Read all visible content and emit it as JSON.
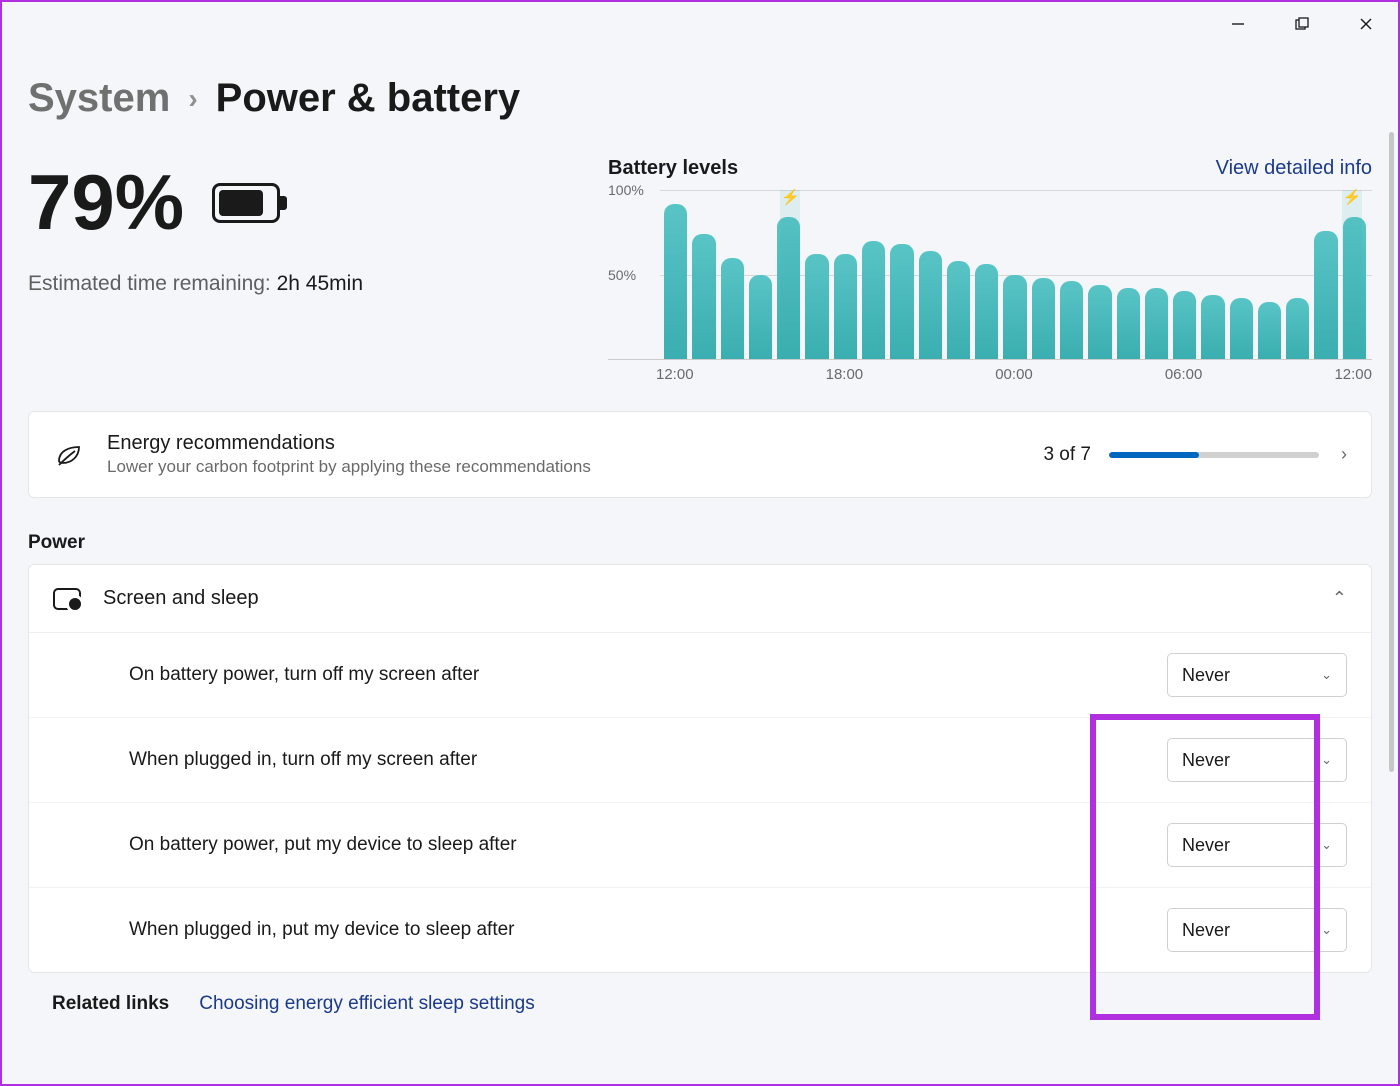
{
  "breadcrumb": {
    "parent": "System",
    "current": "Power & battery"
  },
  "battery": {
    "percent": "79%",
    "estimate_label": "Estimated time remaining:",
    "estimate_value": "2h 45min"
  },
  "chart_header": {
    "title": "Battery levels",
    "link": "View detailed info"
  },
  "chart_data": {
    "type": "bar",
    "ylabel": "",
    "ylim": [
      0,
      100
    ],
    "yticks": [
      "50%",
      "100%"
    ],
    "xticks": [
      "12:00",
      "18:00",
      "00:00",
      "06:00",
      "12:00"
    ],
    "charging_markers_at_index": [
      4,
      24
    ],
    "values": [
      92,
      74,
      60,
      50,
      84,
      62,
      62,
      70,
      68,
      64,
      58,
      56,
      50,
      48,
      46,
      44,
      42,
      42,
      40,
      38,
      36,
      34,
      36,
      76,
      84
    ]
  },
  "energy": {
    "title": "Energy recommendations",
    "subtitle": "Lower your carbon footprint by applying these recommendations",
    "count": "3 of 7",
    "progress_pct": 43
  },
  "power_section": "Power",
  "screen_sleep": {
    "title": "Screen and sleep",
    "rows": [
      {
        "label": "On battery power, turn off my screen after",
        "value": "Never"
      },
      {
        "label": "When plugged in, turn off my screen after",
        "value": "Never"
      },
      {
        "label": "On battery power, put my device to sleep after",
        "value": "Never"
      },
      {
        "label": "When plugged in, put my device to sleep after",
        "value": "Never"
      }
    ]
  },
  "related": {
    "label": "Related links",
    "link": "Choosing energy efficient sleep settings"
  }
}
